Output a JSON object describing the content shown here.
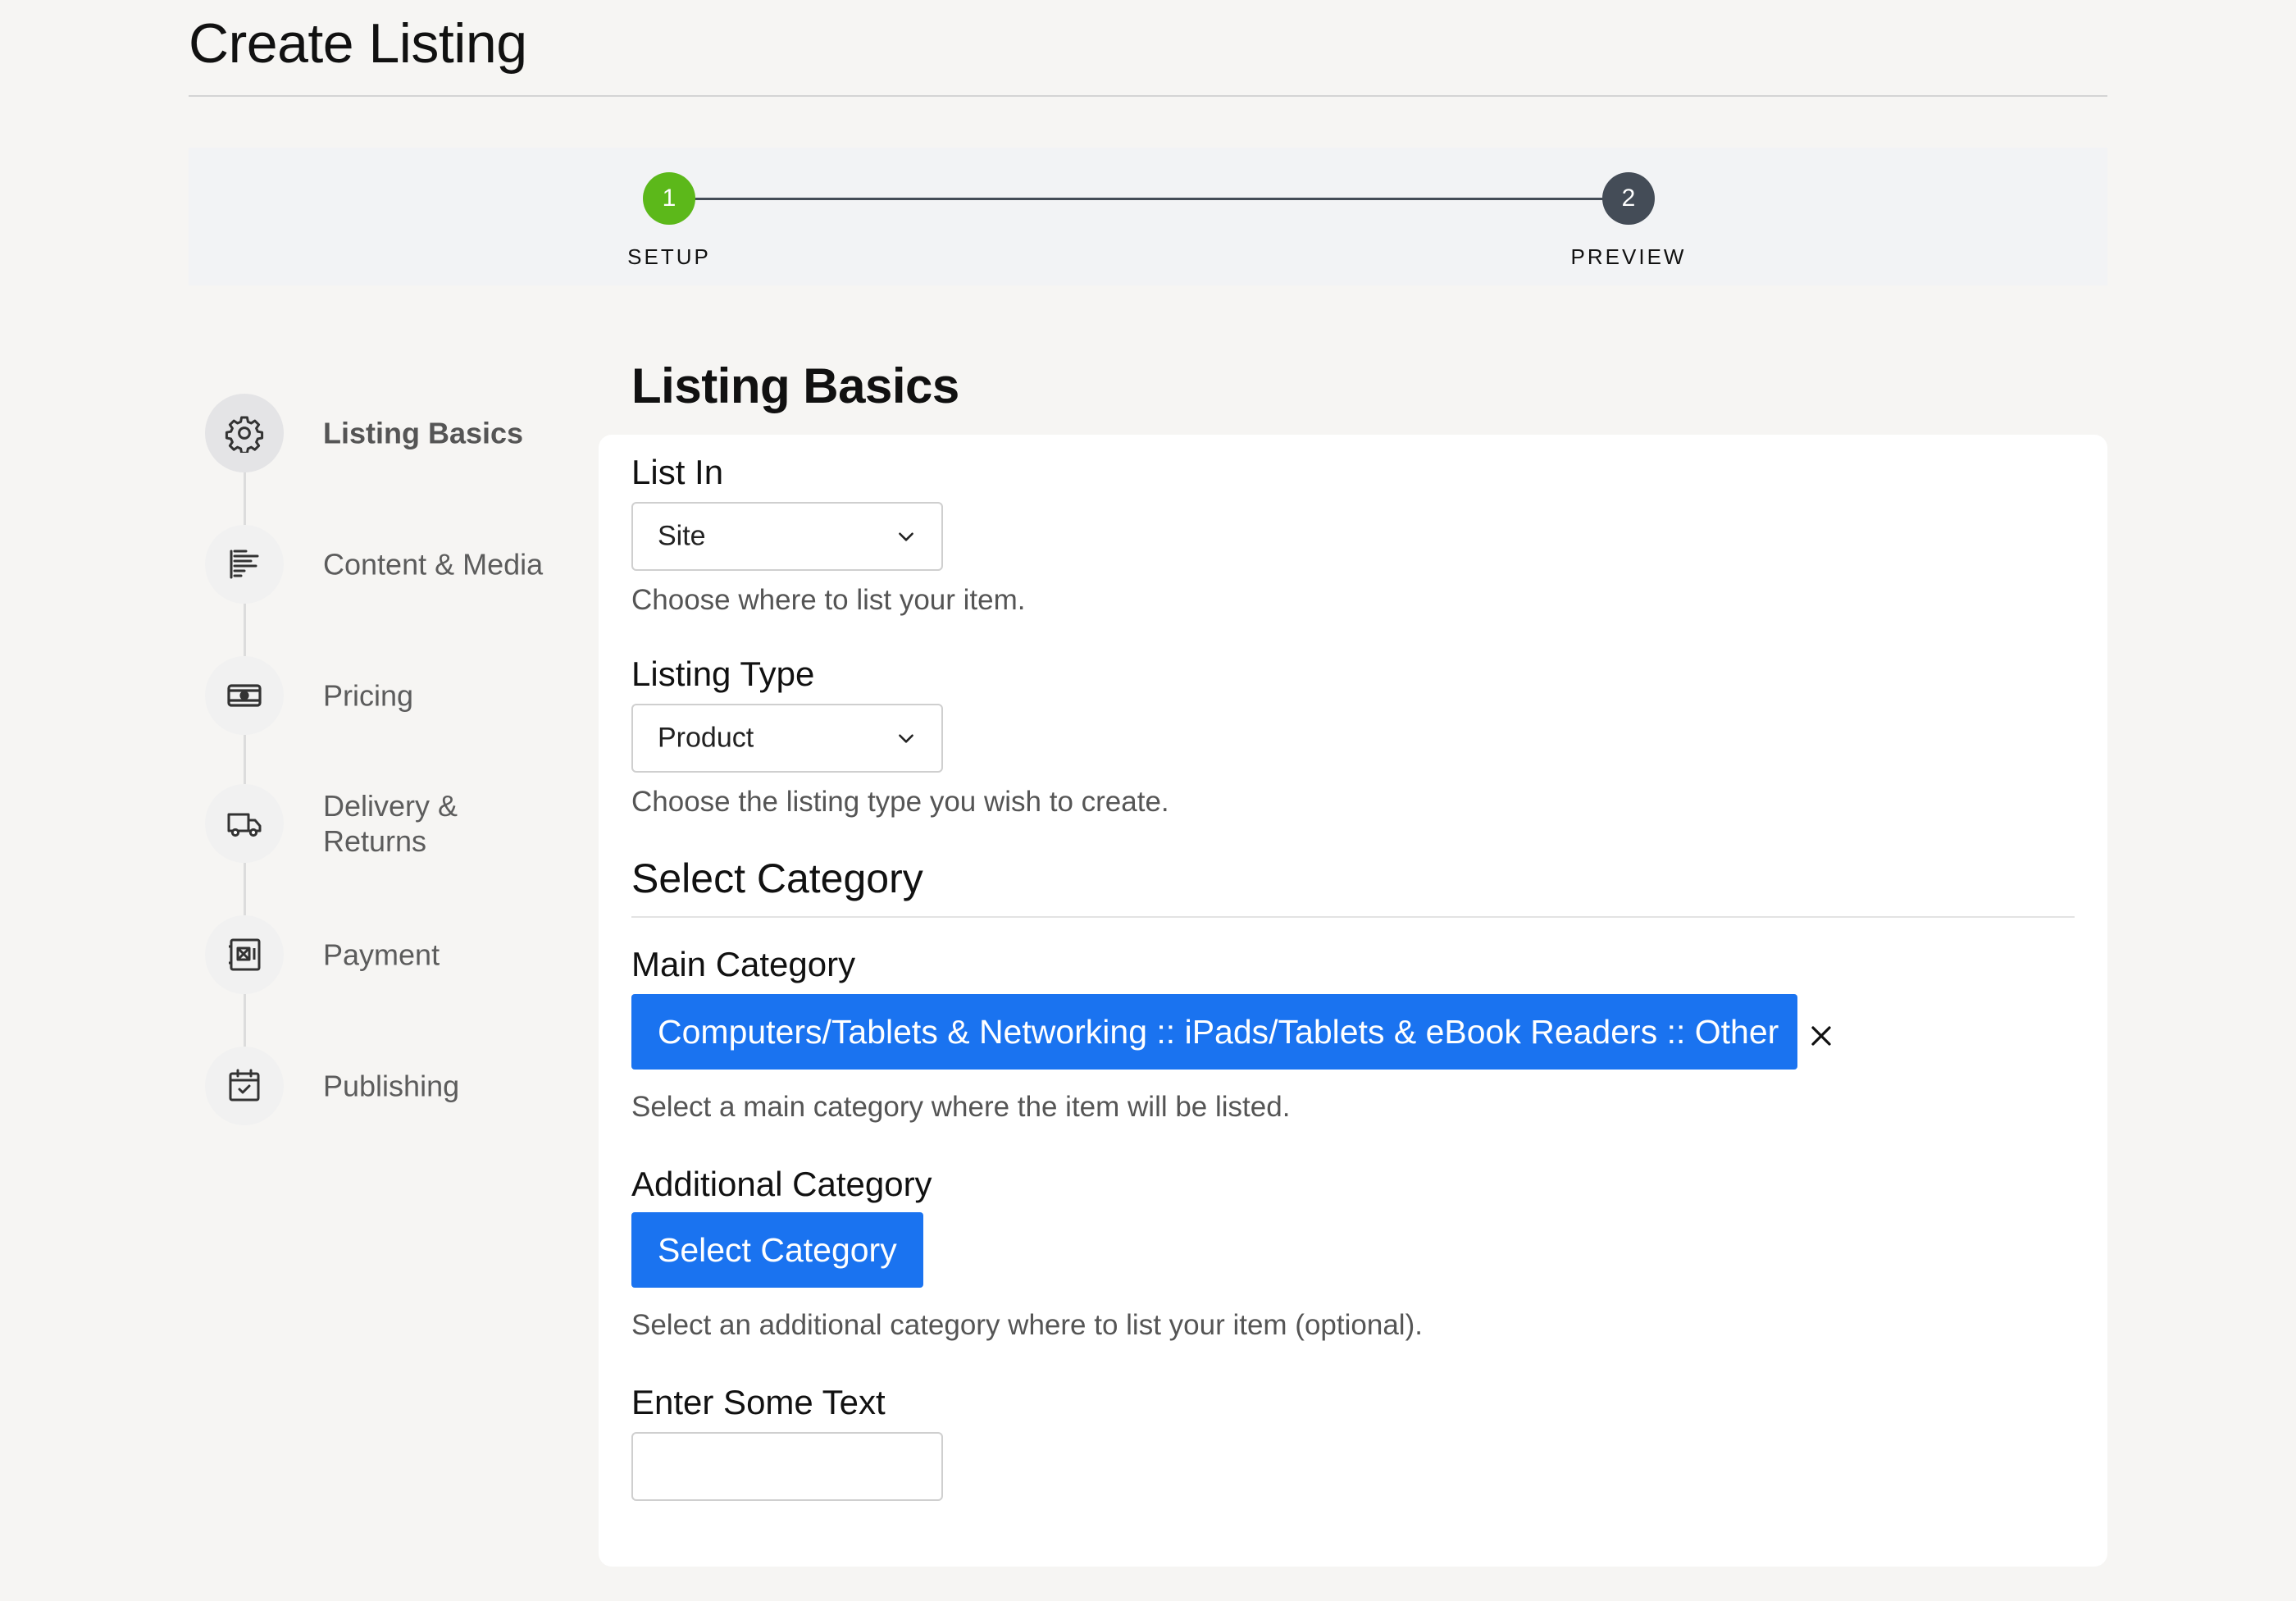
{
  "page": {
    "title": "Create Listing"
  },
  "stepper": {
    "steps": [
      {
        "number": "1",
        "label": "SETUP",
        "status_color": "#5cb81a"
      },
      {
        "number": "2",
        "label": "PREVIEW",
        "status_color": "#444c57"
      }
    ]
  },
  "sidebar": {
    "items": [
      {
        "label": "Listing Basics",
        "icon": "gear-icon",
        "active": true
      },
      {
        "label": "Content & Media",
        "icon": "text-lines-icon",
        "active": false
      },
      {
        "label": "Pricing",
        "icon": "money-icon",
        "active": false
      },
      {
        "label_line1": "Delivery &",
        "label_line2": "Returns",
        "icon": "truck-icon",
        "active": false
      },
      {
        "label": "Payment",
        "icon": "safe-icon",
        "active": false
      },
      {
        "label": "Publishing",
        "icon": "calendar-check-icon",
        "active": false
      }
    ]
  },
  "main": {
    "heading": "Listing Basics",
    "list_in": {
      "label": "List In",
      "value": "Site",
      "help": "Choose where to list your item."
    },
    "listing_type": {
      "label": "Listing Type",
      "value": "Product",
      "help": "Choose the listing type you wish to create."
    },
    "select_category": {
      "title": "Select Category"
    },
    "main_category": {
      "label": "Main Category",
      "value": "Computers/Tablets & Networking :: iPads/Tablets & eBook Readers :: Other",
      "help": "Select a main category where the item will be listed."
    },
    "additional_category": {
      "label": "Additional Category",
      "button": "Select Category",
      "help": "Select an additional category where to list your item (optional)."
    },
    "enter_text": {
      "label": "Enter Some Text",
      "value": ""
    }
  },
  "colors": {
    "accent": "#1a73f0",
    "step_active": "#5cb81a",
    "step_inactive": "#444c57"
  }
}
